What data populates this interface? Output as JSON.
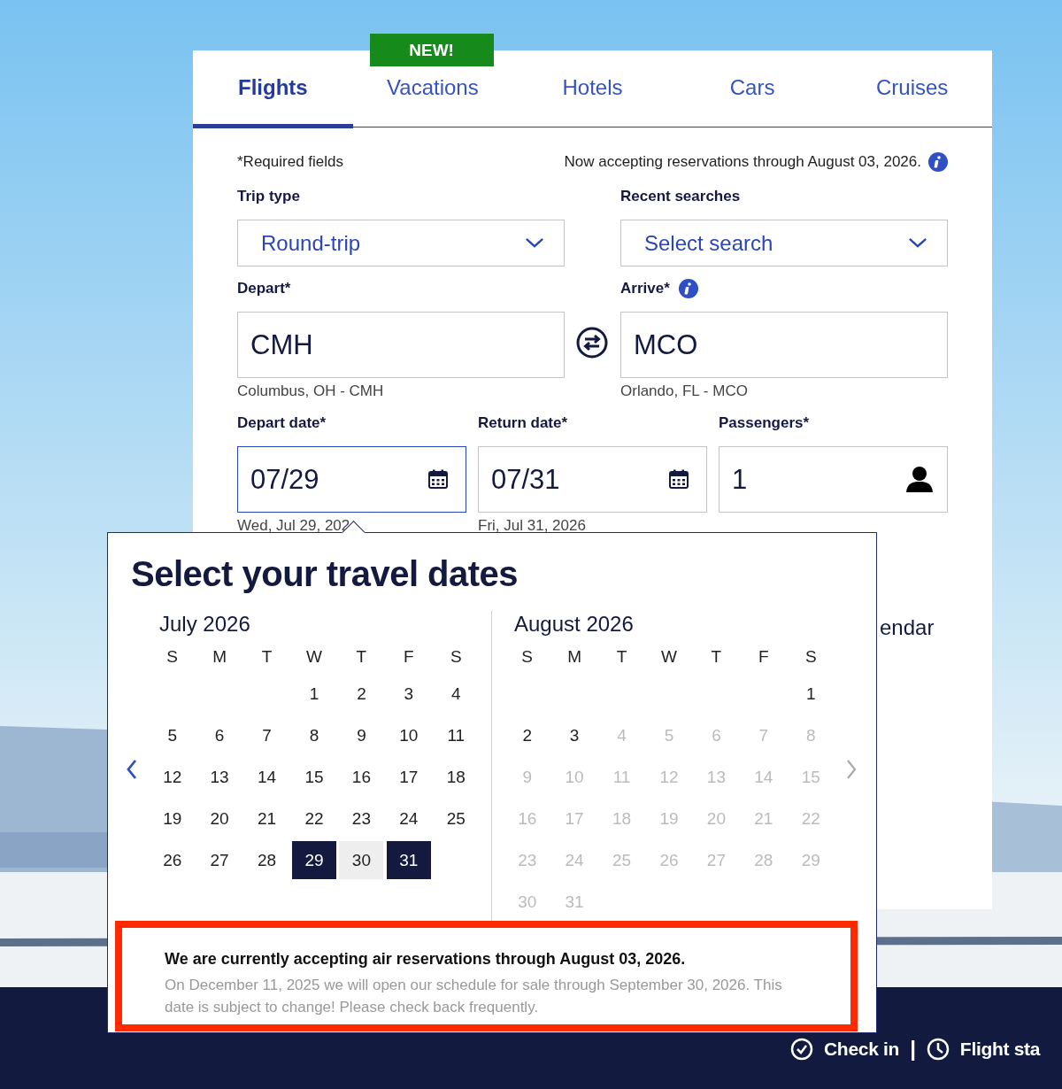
{
  "tabs": [
    {
      "label": "Flights",
      "selected": true
    },
    {
      "label": "Vacations",
      "selected": false,
      "badge": "NEW!"
    },
    {
      "label": "Hotels",
      "selected": false
    },
    {
      "label": "Cars",
      "selected": false
    },
    {
      "label": "Cruises",
      "selected": false
    }
  ],
  "form": {
    "required_note": "*Required fields",
    "notice": "Now accepting reservations through August 03, 2026.",
    "trip_type": {
      "label": "Trip type",
      "value": "Round-trip"
    },
    "recent_searches": {
      "label": "Recent searches",
      "value": "Select search"
    },
    "depart": {
      "label": "Depart*",
      "value": "CMH",
      "hint": "Columbus, OH - CMH"
    },
    "arrive": {
      "label": "Arrive*",
      "value": "MCO",
      "hint": "Orlando, FL - MCO"
    },
    "depart_date": {
      "label": "Depart date*",
      "value": "07/29",
      "hint": "Wed, Jul 29, 202",
      "focused": true
    },
    "return_date": {
      "label": "Return date*",
      "value": "07/31",
      "hint": "Fri, Jul 31, 2026",
      "focused": false
    },
    "passengers": {
      "label": "Passengers*",
      "value": "1"
    },
    "partial_link": "endar"
  },
  "date_picker": {
    "title": "Select your travel dates",
    "months": [
      {
        "name": "July 2026",
        "weekdays": [
          "S",
          "M",
          "T",
          "W",
          "T",
          "F",
          "S"
        ],
        "weeks": [
          {
            "starts_mid_week": true,
            "days": [
              {
                "day": "1",
                "selected": false,
                "in_range": false,
                "disabled": false
              },
              {
                "day": "2",
                "selected": false,
                "in_range": false,
                "disabled": false
              },
              {
                "day": "3",
                "selected": false,
                "in_range": false,
                "disabled": false
              },
              {
                "day": "4",
                "selected": false,
                "in_range": false,
                "disabled": false
              }
            ]
          },
          {
            "days": [
              {
                "day": "5",
                "selected": false,
                "in_range": false,
                "disabled": false
              },
              {
                "day": "6",
                "selected": false,
                "in_range": false,
                "disabled": false
              },
              {
                "day": "7",
                "selected": false,
                "in_range": false,
                "disabled": false
              },
              {
                "day": "8",
                "selected": false,
                "in_range": false,
                "disabled": false
              },
              {
                "day": "9",
                "selected": false,
                "in_range": false,
                "disabled": false
              },
              {
                "day": "10",
                "selected": false,
                "in_range": false,
                "disabled": false
              },
              {
                "day": "11",
                "selected": false,
                "in_range": false,
                "disabled": false
              }
            ]
          },
          {
            "days": [
              {
                "day": "12",
                "selected": false,
                "in_range": false,
                "disabled": false
              },
              {
                "day": "13",
                "selected": false,
                "in_range": false,
                "disabled": false
              },
              {
                "day": "14",
                "selected": false,
                "in_range": false,
                "disabled": false
              },
              {
                "day": "15",
                "selected": false,
                "in_range": false,
                "disabled": false
              },
              {
                "day": "16",
                "selected": false,
                "in_range": false,
                "disabled": false
              },
              {
                "day": "17",
                "selected": false,
                "in_range": false,
                "disabled": false
              },
              {
                "day": "18",
                "selected": false,
                "in_range": false,
                "disabled": false
              }
            ]
          },
          {
            "days": [
              {
                "day": "19",
                "selected": false,
                "in_range": false,
                "disabled": false
              },
              {
                "day": "20",
                "selected": false,
                "in_range": false,
                "disabled": false
              },
              {
                "day": "21",
                "selected": false,
                "in_range": false,
                "disabled": false
              },
              {
                "day": "22",
                "selected": false,
                "in_range": false,
                "disabled": false
              },
              {
                "day": "23",
                "selected": false,
                "in_range": false,
                "disabled": false
              },
              {
                "day": "24",
                "selected": false,
                "in_range": false,
                "disabled": false
              },
              {
                "day": "25",
                "selected": false,
                "in_range": false,
                "disabled": false
              }
            ]
          },
          {
            "starts_mid_week": false,
            "days": [
              {
                "day": "26",
                "selected": false,
                "in_range": false,
                "disabled": false
              },
              {
                "day": "27",
                "selected": false,
                "in_range": false,
                "disabled": false
              },
              {
                "day": "28",
                "selected": false,
                "in_range": false,
                "disabled": false
              },
              {
                "day": "29",
                "selected": true,
                "in_range": false,
                "disabled": false
              },
              {
                "day": "30",
                "selected": false,
                "in_range": true,
                "disabled": false
              },
              {
                "day": "31",
                "selected": true,
                "in_range": false,
                "disabled": false
              }
            ]
          }
        ]
      },
      {
        "name": "August 2026",
        "weekdays": [
          "S",
          "M",
          "T",
          "W",
          "T",
          "F",
          "S"
        ],
        "weeks": [
          {
            "starts_mid_week": true,
            "days": [
              {
                "day": "1",
                "selected": false,
                "in_range": false,
                "disabled": false
              }
            ]
          },
          {
            "days": [
              {
                "day": "2",
                "selected": false,
                "in_range": false,
                "disabled": false
              },
              {
                "day": "3",
                "selected": false,
                "in_range": false,
                "disabled": false
              },
              {
                "day": "4",
                "selected": false,
                "in_range": false,
                "disabled": true
              },
              {
                "day": "5",
                "selected": false,
                "in_range": false,
                "disabled": true
              },
              {
                "day": "6",
                "selected": false,
                "in_range": false,
                "disabled": true
              },
              {
                "day": "7",
                "selected": false,
                "in_range": false,
                "disabled": true
              },
              {
                "day": "8",
                "selected": false,
                "in_range": false,
                "disabled": true
              }
            ]
          },
          {
            "days": [
              {
                "day": "9",
                "selected": false,
                "in_range": false,
                "disabled": true
              },
              {
                "day": "10",
                "selected": false,
                "in_range": false,
                "disabled": true
              },
              {
                "day": "11",
                "selected": false,
                "in_range": false,
                "disabled": true
              },
              {
                "day": "12",
                "selected": false,
                "in_range": false,
                "disabled": true
              },
              {
                "day": "13",
                "selected": false,
                "in_range": false,
                "disabled": true
              },
              {
                "day": "14",
                "selected": false,
                "in_range": false,
                "disabled": true
              },
              {
                "day": "15",
                "selected": false,
                "in_range": false,
                "disabled": true
              }
            ]
          },
          {
            "days": [
              {
                "day": "16",
                "selected": false,
                "in_range": false,
                "disabled": true
              },
              {
                "day": "17",
                "selected": false,
                "in_range": false,
                "disabled": true
              },
              {
                "day": "18",
                "selected": false,
                "in_range": false,
                "disabled": true
              },
              {
                "day": "19",
                "selected": false,
                "in_range": false,
                "disabled": true
              },
              {
                "day": "20",
                "selected": false,
                "in_range": false,
                "disabled": true
              },
              {
                "day": "21",
                "selected": false,
                "in_range": false,
                "disabled": true
              },
              {
                "day": "22",
                "selected": false,
                "in_range": false,
                "disabled": true
              }
            ]
          },
          {
            "days": [
              {
                "day": "23",
                "selected": false,
                "in_range": false,
                "disabled": true
              },
              {
                "day": "24",
                "selected": false,
                "in_range": false,
                "disabled": true
              },
              {
                "day": "25",
                "selected": false,
                "in_range": false,
                "disabled": true
              },
              {
                "day": "26",
                "selected": false,
                "in_range": false,
                "disabled": true
              },
              {
                "day": "27",
                "selected": false,
                "in_range": false,
                "disabled": true
              },
              {
                "day": "28",
                "selected": false,
                "in_range": false,
                "disabled": true
              },
              {
                "day": "29",
                "selected": false,
                "in_range": false,
                "disabled": true
              }
            ]
          },
          {
            "starts_mid_week": false,
            "days": [
              {
                "day": "30",
                "selected": false,
                "in_range": false,
                "disabled": true
              },
              {
                "day": "31",
                "selected": false,
                "in_range": false,
                "disabled": true
              }
            ]
          }
        ]
      }
    ],
    "notice_title": "We are currently accepting air reservations through August 03, 2026.",
    "notice_body": "On December 11, 2025 we will open our schedule for sale through September 30, 2026. This date is subject to change! Please check back frequently."
  },
  "footer": {
    "items": [
      {
        "kind": "check",
        "label": "Check in"
      },
      {
        "kind": "clock",
        "label": "Flight sta"
      }
    ],
    "separator": "|"
  }
}
